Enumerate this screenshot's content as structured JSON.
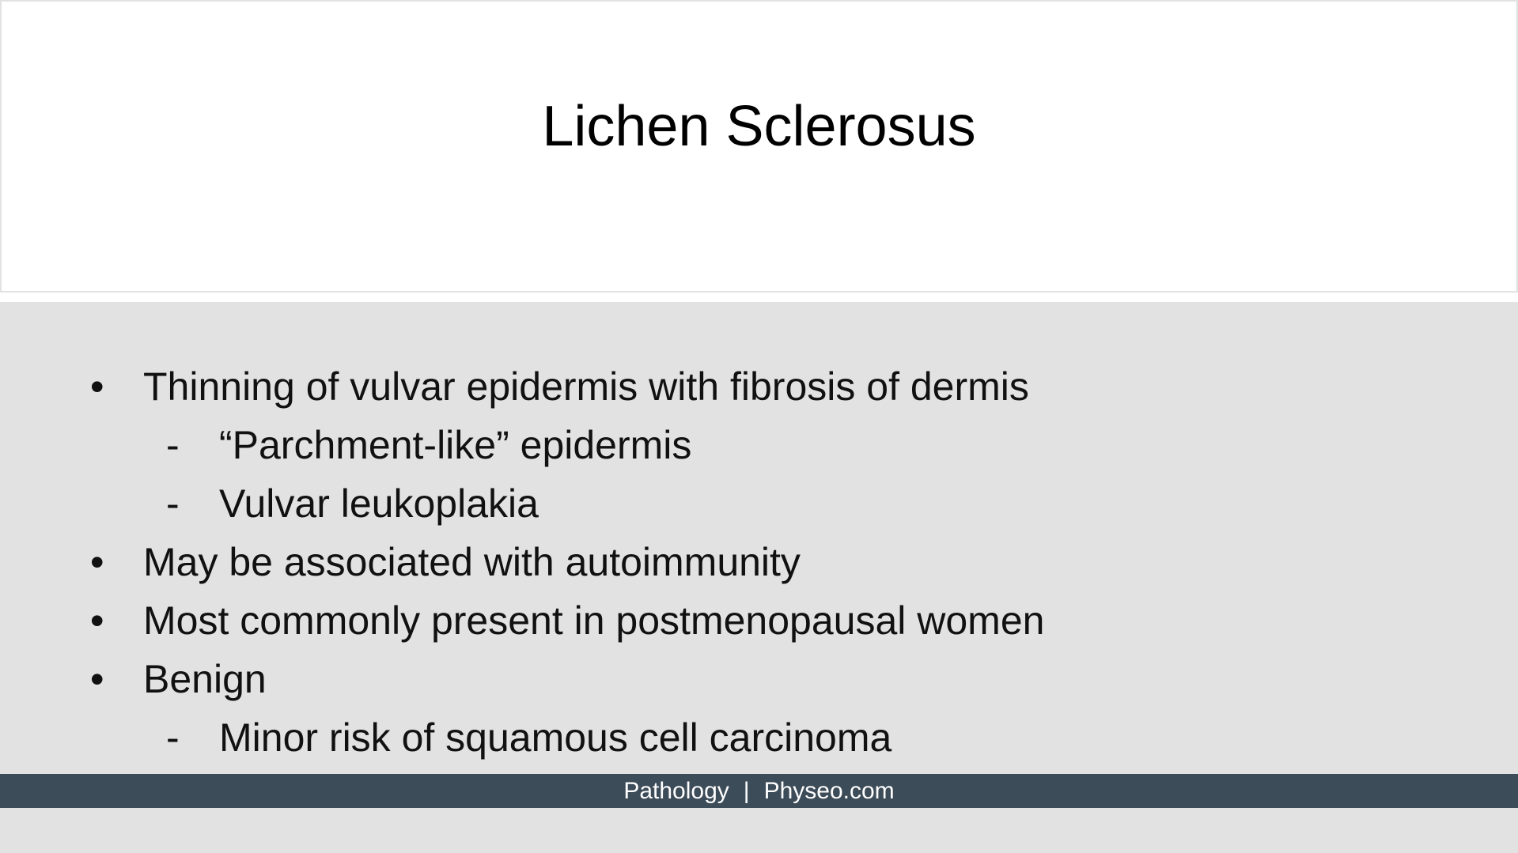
{
  "slide": {
    "title": "Lichen Sclerosus",
    "bullets": [
      {
        "marker": "•",
        "text": "Thinning of vulvar epidermis with fibrosis of dermis"
      },
      {
        "marker": "-",
        "text": "“Parchment-like” epidermis"
      },
      {
        "marker": "-",
        "text": "Vulvar leukoplakia"
      },
      {
        "marker": "•",
        "text": "May be associated with autoimmunity"
      },
      {
        "marker": "•",
        "text": "Most commonly present in postmenopausal women"
      },
      {
        "marker": "•",
        "text": "Benign"
      },
      {
        "marker": "-",
        "text": "Minor risk of squamous cell carcinoma"
      }
    ]
  },
  "footer": {
    "left": "Pathology",
    "separator": "|",
    "right": "Physeo.com"
  },
  "colors": {
    "background": "#e2e2e2",
    "title_panel": "#ffffff",
    "footer_bar": "#3d4c59"
  }
}
